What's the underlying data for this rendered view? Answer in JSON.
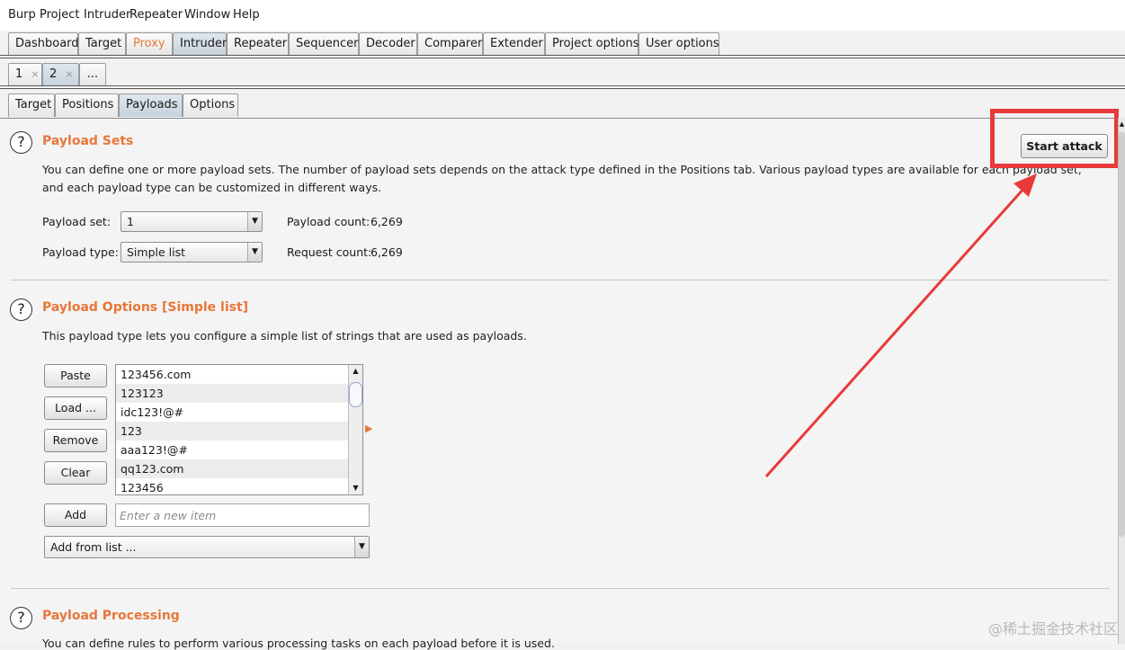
{
  "menu": [
    "Burp",
    "Project",
    "Intruder",
    "Repeater",
    "Window",
    "Help"
  ],
  "main_tabs": [
    "Dashboard",
    "Target",
    "Proxy",
    "Intruder",
    "Repeater",
    "Sequencer",
    "Decoder",
    "Comparer",
    "Extender",
    "Project options",
    "User options"
  ],
  "attack_tabs": [
    {
      "label": "1",
      "close": "×"
    },
    {
      "label": "2",
      "close": "×"
    },
    {
      "label": "..."
    }
  ],
  "sub_tabs": [
    "Target",
    "Positions",
    "Payloads",
    "Options"
  ],
  "payload_sets": {
    "help": "?",
    "title": "Payload Sets",
    "desc_line1": "You can define one or more payload sets. The number of payload sets depends on the attack type defined in the Positions tab. Various payload types are available for each payload set,",
    "desc_line2": "and each payload type can be customized in different ways.",
    "set_label": "Payload set:",
    "set_value": "1",
    "type_label": "Payload type:",
    "type_value": "Simple list",
    "count_label": "Payload count:",
    "count_value": "6,269",
    "request_label": "Request count:",
    "request_value": "6,269",
    "start_button": "Start attack"
  },
  "payload_options": {
    "help": "?",
    "title": "Payload Options [Simple list]",
    "desc": "This payload type lets you configure a simple list of strings that are used as payloads.",
    "buttons": {
      "paste": "Paste",
      "load": "Load ...",
      "remove": "Remove",
      "clear": "Clear",
      "add": "Add"
    },
    "items": [
      "123456.com",
      "123123",
      "idc123!@#",
      "123",
      "aaa123!@#",
      "qq123.com",
      "123456"
    ],
    "add_placeholder": "Enter a new item",
    "add_from_list": "Add from list ..."
  },
  "payload_processing": {
    "help": "?",
    "title": "Payload Processing",
    "desc": "You can define rules to perform various processing tasks on each payload before it is used."
  },
  "annotation_color": "#e83a3a",
  "accent_color": "#e8773a",
  "watermark": "@稀土掘金技术社区"
}
